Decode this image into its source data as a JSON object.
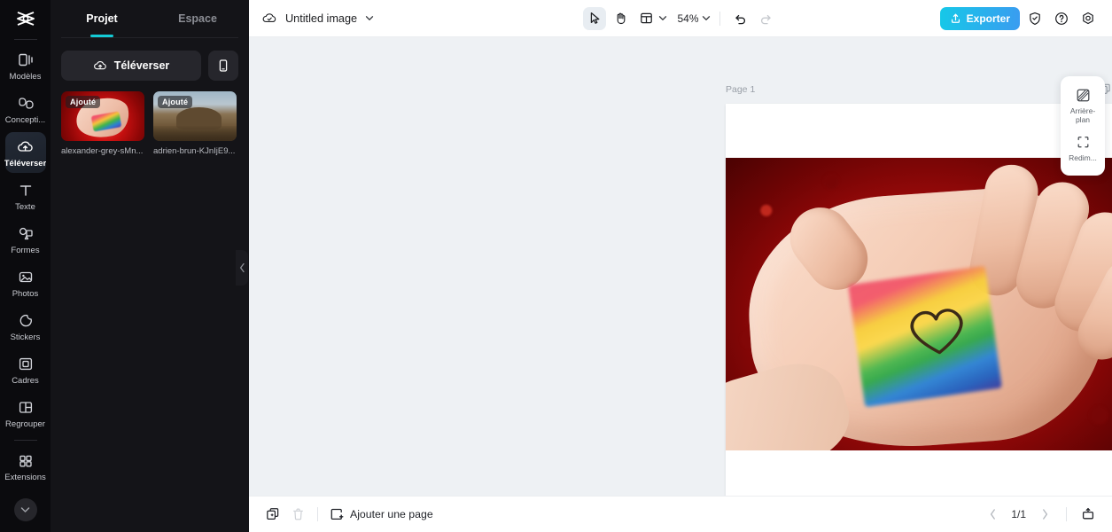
{
  "rail": {
    "logo_icon": "capcut-logo-icon",
    "items": [
      {
        "label": "Modèles",
        "icon": "templates-icon",
        "active": false
      },
      {
        "label": "Concepti...",
        "icon": "design-icon",
        "active": false
      },
      {
        "label": "Téléverser",
        "icon": "upload-cloud-icon",
        "active": true
      },
      {
        "label": "Texte",
        "icon": "text-icon",
        "active": false
      },
      {
        "label": "Formes",
        "icon": "shapes-icon",
        "active": false
      },
      {
        "label": "Photos",
        "icon": "photo-icon",
        "active": false
      },
      {
        "label": "Stickers",
        "icon": "sticker-icon",
        "active": false
      },
      {
        "label": "Cadres",
        "icon": "frame-icon",
        "active": false
      },
      {
        "label": "Regrouper",
        "icon": "group-icon",
        "active": false
      },
      {
        "label": "Extensions",
        "icon": "extensions-icon",
        "active": false
      }
    ],
    "collapse_icon": "chevron-down-icon"
  },
  "panel": {
    "tabs": [
      {
        "label": "Projet",
        "active": true
      },
      {
        "label": "Espace",
        "active": false
      }
    ],
    "upload_button": "Téléverser",
    "upload_icon": "upload-cloud-icon",
    "phone_icon": "mobile-phone-icon",
    "thumbnails": [
      {
        "badge": "Ajouté",
        "name": "alexander-grey-sMn...",
        "art": "hand"
      },
      {
        "badge": "Ajouté",
        "name": "adrien-brun-KJnIjE9...",
        "art": "mountain"
      }
    ],
    "collapse_icon": "chevron-left-icon"
  },
  "topbar": {
    "cloud_icon": "cloud-saved-icon",
    "document_title": "Untitled image",
    "title_caret_icon": "chevron-down-icon",
    "tools": [
      {
        "name": "select-tool",
        "icon": "cursor-arrow-icon",
        "selected": true
      },
      {
        "name": "hand-tool",
        "icon": "hand-icon",
        "selected": false
      },
      {
        "name": "layout-tool",
        "icon": "layout-grid-icon",
        "selected": false
      }
    ],
    "layout_caret_icon": "chevron-down-icon",
    "zoom_value": "54%",
    "zoom_caret_icon": "chevron-down-icon",
    "undo_icon": "undo-arrow-icon",
    "redo_icon": "redo-arrow-icon",
    "export_button": "Exporter",
    "export_icon": "export-upload-icon",
    "shield_icon": "shield-check-icon",
    "help_icon": "question-circle-icon",
    "settings_icon": "gear-icon"
  },
  "canvas": {
    "page_label": "Page 1",
    "duplicate_icon": "duplicate-page-icon",
    "more_icon": "more-horizontal-icon"
  },
  "right_panel": {
    "items": [
      {
        "label": "Arrière-plan",
        "icon": "background-checker-icon"
      },
      {
        "label": "Redim...",
        "icon": "resize-icon"
      }
    ]
  },
  "bottombar": {
    "duplicate_icon": "duplicate-icon",
    "delete_icon": "trash-icon",
    "add_page_label": "Ajouter une page",
    "add_page_icon": "add-page-icon",
    "prev_icon": "chevron-left-icon",
    "page_indicator": "1/1",
    "next_icon": "chevron-right-icon",
    "present_icon": "present-icon"
  },
  "colors": {
    "accent_teal": "#14cbd6",
    "export_gradient_start": "#16c8e8",
    "export_gradient_end": "#3a9cf0",
    "rail_bg": "#0b0b0e",
    "panel_bg": "#141418",
    "canvas_bg": "#eef1f4"
  }
}
